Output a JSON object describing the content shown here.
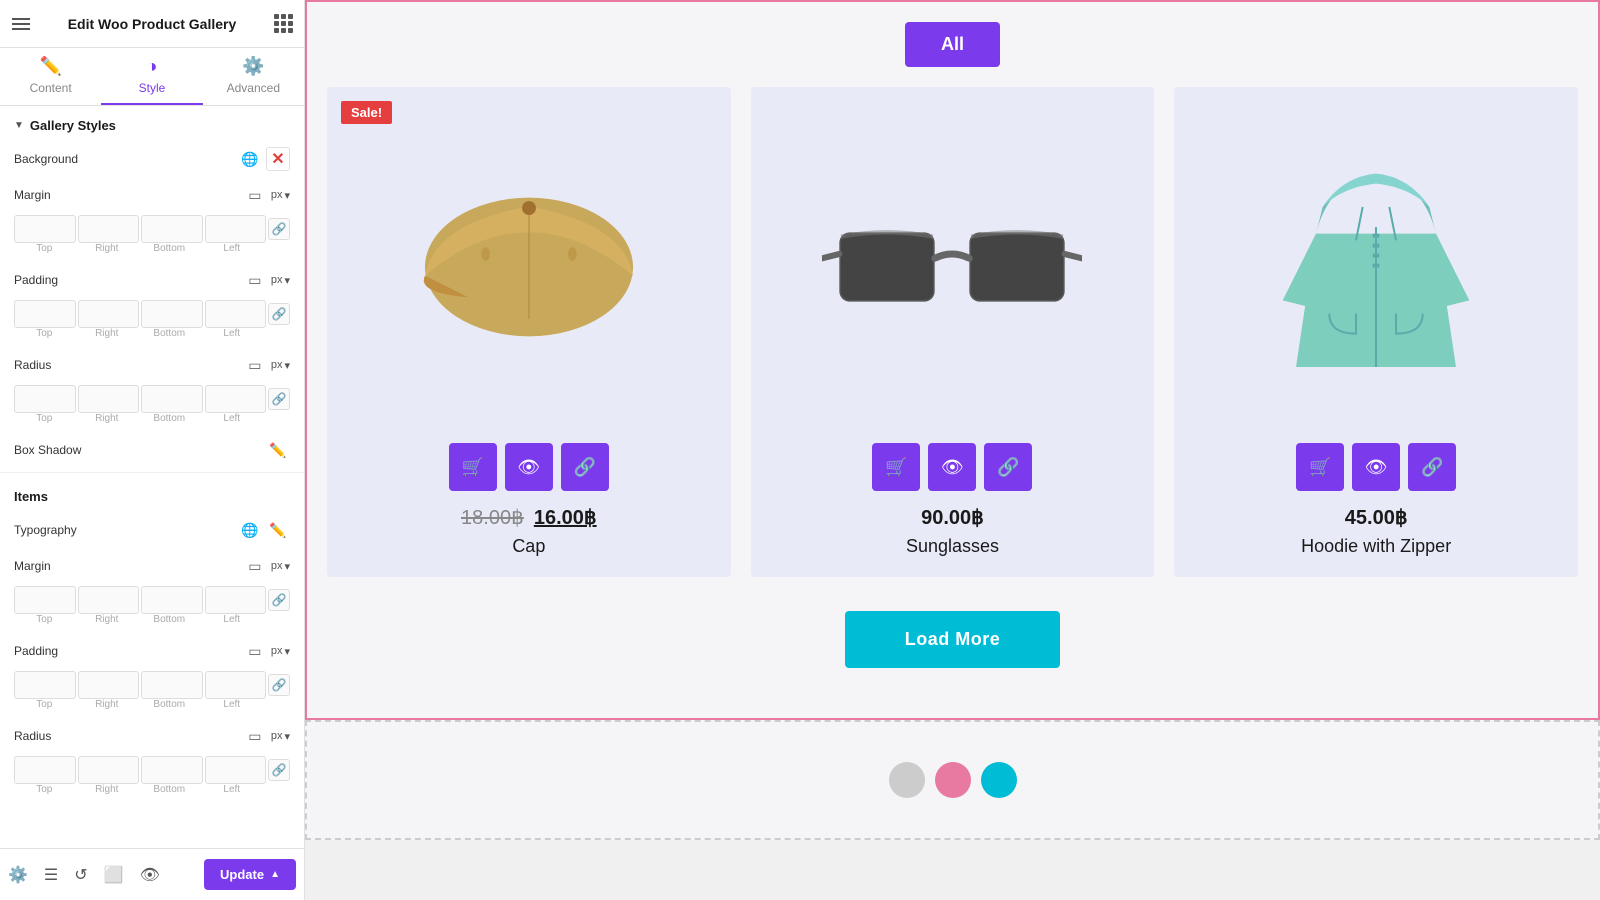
{
  "panel": {
    "title": "Edit Woo Product Gallery",
    "tabs": [
      {
        "id": "content",
        "label": "Content",
        "icon": "✏️"
      },
      {
        "id": "style",
        "label": "Style",
        "icon": "◑"
      },
      {
        "id": "advanced",
        "label": "Advanced",
        "icon": "⚙️"
      }
    ],
    "active_tab": "style",
    "sections": {
      "gallery_styles": {
        "title": "Gallery Styles",
        "expanded": true,
        "properties": {
          "background": {
            "label": "Background"
          },
          "margin1": {
            "label": "Margin",
            "unit": "px",
            "inputs": [
              "",
              "",
              "",
              ""
            ],
            "labels": [
              "Top",
              "Right",
              "Bottom",
              "Left"
            ]
          },
          "padding1": {
            "label": "Padding",
            "unit": "px",
            "inputs": [
              "",
              "",
              "",
              ""
            ],
            "labels": [
              "Top",
              "Right",
              "Bottom",
              "Left"
            ]
          },
          "radius1": {
            "label": "Radius",
            "unit": "px",
            "inputs": [
              "",
              "",
              "",
              ""
            ],
            "labels": [
              "Top",
              "Right",
              "Bottom",
              "Left"
            ]
          },
          "box_shadow": {
            "label": "Box Shadow"
          }
        }
      },
      "items": {
        "title": "Items",
        "properties": {
          "typography": {
            "label": "Typography"
          },
          "margin2": {
            "label": "Margin",
            "unit": "px",
            "inputs": [
              "",
              "",
              "",
              ""
            ],
            "labels": [
              "Top",
              "Right",
              "Bottom",
              "Left"
            ]
          },
          "padding2": {
            "label": "Padding",
            "unit": "px",
            "inputs": [
              "",
              "",
              "",
              ""
            ],
            "labels": [
              "Top",
              "Right",
              "Bottom",
              "Left"
            ]
          },
          "radius2": {
            "label": "Radius",
            "unit": "px",
            "inputs": [
              "",
              "",
              "",
              ""
            ],
            "labels": [
              "Top",
              "Right",
              "Bottom",
              "Left"
            ]
          }
        }
      }
    }
  },
  "bottom_bar": {
    "update_label": "Update"
  },
  "gallery": {
    "filter_tabs": [
      {
        "label": "All",
        "active": true
      }
    ],
    "products": [
      {
        "id": 1,
        "name": "Cap",
        "price_old": "18.00฿",
        "price_new": "16.00฿",
        "sale": true,
        "image_type": "cap"
      },
      {
        "id": 2,
        "name": "Sunglasses",
        "price": "90.00฿",
        "sale": false,
        "image_type": "sunglasses"
      },
      {
        "id": 3,
        "name": "Hoodie with Zipper",
        "price": "45.00฿",
        "sale": false,
        "image_type": "hoodie"
      }
    ],
    "load_more_label": "Load More",
    "sale_badge": "Sale!"
  },
  "below_gallery": {
    "dots": [
      {
        "color": "#cccccc"
      },
      {
        "color": "#e879a0"
      },
      {
        "color": "#00bcd4"
      }
    ]
  }
}
